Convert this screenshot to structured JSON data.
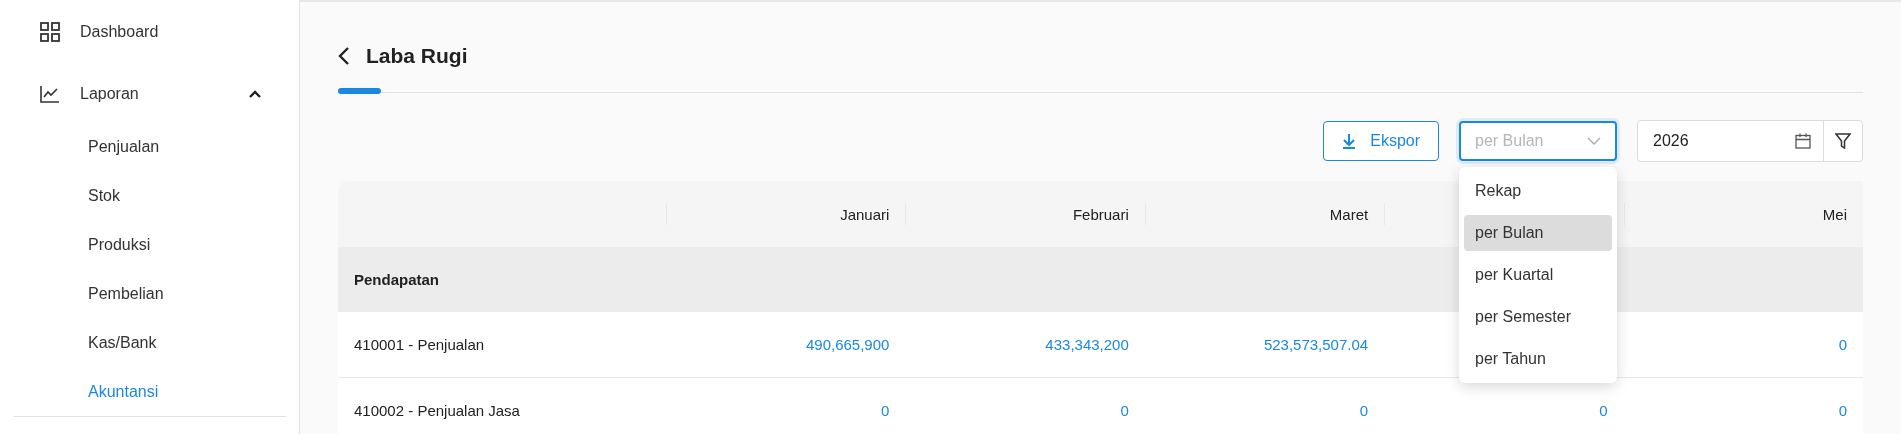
{
  "sidebar": {
    "items": [
      {
        "label": "Dashboard"
      },
      {
        "label": "Laporan",
        "expanded": true,
        "children": [
          {
            "label": "Penjualan",
            "selected": false
          },
          {
            "label": "Stok",
            "selected": false
          },
          {
            "label": "Produksi",
            "selected": false
          },
          {
            "label": "Pembelian",
            "selected": false
          },
          {
            "label": "Kas/Bank",
            "selected": false
          },
          {
            "label": "Akuntansi",
            "selected": true
          }
        ]
      }
    ]
  },
  "page": {
    "title": "Laba Rugi"
  },
  "toolbar": {
    "export_button": "Ekspor",
    "period_select": {
      "placeholder": "per Bulan",
      "options": [
        {
          "label": "Rekap",
          "selected": false
        },
        {
          "label": "per Bulan",
          "selected": true
        },
        {
          "label": "per Kuartal",
          "selected": false
        },
        {
          "label": "per Semester",
          "selected": false
        },
        {
          "label": "per Tahun",
          "selected": false
        }
      ]
    },
    "year_field": {
      "value": "2026"
    }
  },
  "table": {
    "columns": {
      "column_1": "Januari",
      "column_2": "Februari",
      "column_3": "Maret",
      "column_5": "Mei"
    },
    "rows": [
      {
        "kind": "section",
        "label": "Pendapatan"
      },
      {
        "kind": "account",
        "label": "410001 - Penjualan",
        "values": {
          "column_1": "490,665,900",
          "column_2": "433,343,200",
          "column_3": "523,573,507.04",
          "column_5": "0"
        }
      },
      {
        "kind": "account",
        "label": "410002 - Penjualan Jasa",
        "values": {
          "column_1": "0",
          "column_2": "0",
          "column_3": "0",
          "column_4": "0",
          "column_5": "0"
        }
      }
    ]
  }
}
